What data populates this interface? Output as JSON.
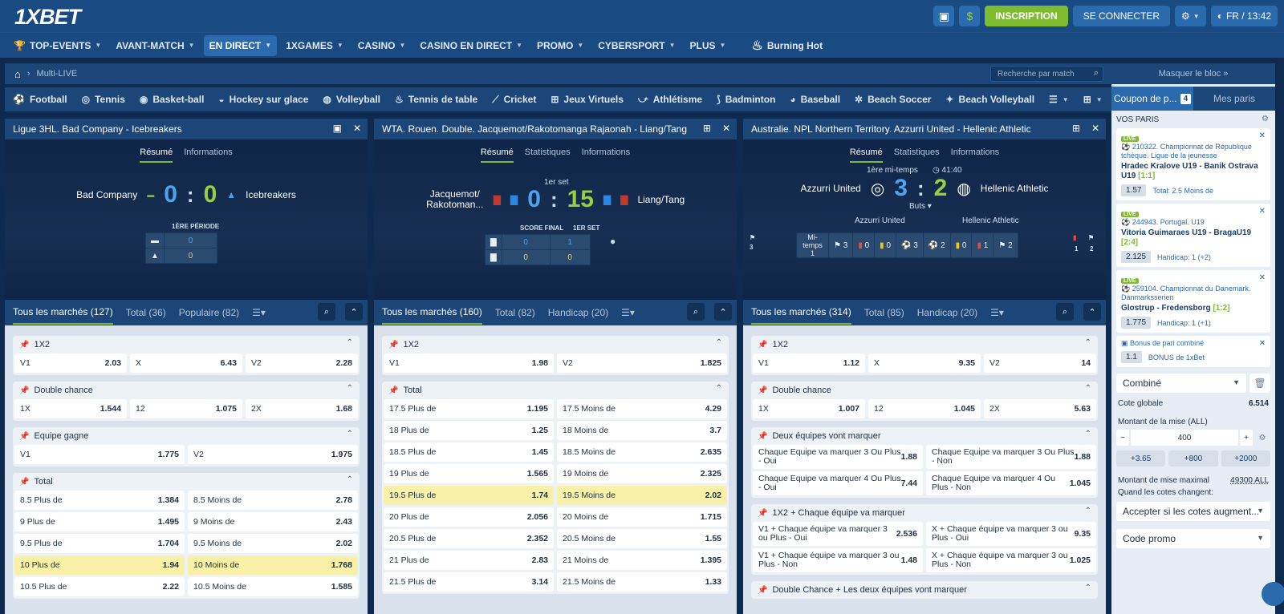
{
  "header": {
    "logo": "1XBET",
    "dollar": "$",
    "register": "INSCRIPTION",
    "login": "SE CONNECTER",
    "lang": "FR / 13:42"
  },
  "nav": {
    "items": [
      "TOP-EVENTS",
      "AVANT-MATCH",
      "EN DIRECT",
      "1XGAMES",
      "CASINO",
      "CASINO EN DIRECT",
      "PROMO",
      "CYBERSPORT",
      "PLUS"
    ],
    "burning": "Burning Hot"
  },
  "breadcrumb": {
    "item": "Multi-LIVE"
  },
  "search": {
    "placeholder": "Recherche par match"
  },
  "sports": [
    "Football",
    "Tennis",
    "Basket-ball",
    "Hockey sur glace",
    "Volleyball",
    "Tennis de table",
    "Cricket",
    "Jeux Virtuels",
    "Athlétisme",
    "Badminton",
    "Baseball",
    "Beach Soccer",
    "Beach Volleyball"
  ],
  "coupon": {
    "hide": "Masquer le bloc",
    "tab1": "Coupon de p...",
    "count": "4",
    "tab2": "Mes paris",
    "vos": "VOS PARIS",
    "bets": [
      {
        "league": "210322. Championnat de République tchèque. Ligue de la jeunesse",
        "match": "Hradec Kralove U19 - Banik Ostrava U19",
        "score": "[1:1]",
        "odd": "1.57",
        "type": "Total: 2.5 Moins de"
      },
      {
        "league": "244943. Portugal. U19",
        "match": "Vitoria Guimaraes U19 - BragaU19",
        "score": "[2:4]",
        "odd": "2.125",
        "type": "Handicap: 1 (+2)"
      },
      {
        "league": "259104. Championnat du Danemark. Danmarksserien",
        "match": "Glostrup - Fredensborg",
        "score": "[1:2]",
        "odd": "1.775",
        "type": "Handicap: 1 (+1)"
      }
    ],
    "bonus": {
      "label": "Bonus de pari combiné",
      "odd": "1.1",
      "name": "BONUS de 1xBet"
    },
    "combine": "Combiné",
    "global_label": "Cote globale",
    "global_value": "6.514",
    "stake_label": "Montant de la mise (ALL)",
    "stake": "400",
    "quick": [
      "+3.65",
      "+800",
      "+2000"
    ],
    "max_label": "Montant de mise maximal",
    "max_value": "49300 ALL",
    "change_label": "Quand les cotes changent:",
    "accept": "Accepter si les cotes augment...",
    "promo": "Code promo"
  },
  "p1": {
    "title": "Ligue 3HL. Bad Company - Icebreakers",
    "tab1": "Résumé",
    "tab2": "Informations",
    "home": "Bad Company",
    "away": "Icebreakers",
    "s1": "0",
    "s2": "0",
    "period": "1ÈRE PÉRIODE",
    "m1": "0",
    "m2": "0",
    "mk": {
      "a": "Tous les marchés (127)",
      "b": "Total (36)",
      "c": "Populaire (82)"
    },
    "g1": {
      "name": "1X2",
      "cells": [
        [
          "V1",
          "2.03"
        ],
        [
          "X",
          "6.43"
        ],
        [
          "V2",
          "2.28"
        ]
      ]
    },
    "g2": {
      "name": "Double chance",
      "cells": [
        [
          "1X",
          "1.544"
        ],
        [
          "12",
          "1.075"
        ],
        [
          "2X",
          "1.68"
        ]
      ]
    },
    "g3": {
      "name": "Equipe gagne",
      "cells": [
        [
          "V1",
          "1.775"
        ],
        [
          "V2",
          "1.975"
        ]
      ]
    },
    "g4": {
      "name": "Total",
      "rows": [
        [
          "8.5 Plus de",
          "1.384",
          "8.5 Moins de",
          "2.78"
        ],
        [
          "9 Plus de",
          "1.495",
          "9 Moins de",
          "2.43"
        ],
        [
          "9.5 Plus de",
          "1.704",
          "9.5 Moins de",
          "2.02"
        ],
        [
          "10 Plus de",
          "1.94",
          "10 Moins de",
          "1.768"
        ],
        [
          "10.5 Plus de",
          "2.22",
          "10.5 Moins de",
          "1.585"
        ]
      ]
    }
  },
  "p2": {
    "title": "WTA. Rouen. Double. Jacquemot/Rakotomanga Rajaonah - Liang/Tang",
    "tab1": "Résumé",
    "tab2": "Statistiques",
    "tab3": "Informations",
    "home": "Jacquemot/ Rakotoman...",
    "away": "Liang/Tang",
    "set": "1er set",
    "s1": "0",
    "s2": "15",
    "h1": "SCORE FINAL",
    "h2": "1ER SET",
    "r1": [
      "0",
      "1"
    ],
    "r2": [
      "0",
      "0"
    ],
    "mk": {
      "a": "Tous les marchés (160)",
      "b": "Total (82)",
      "c": "Handicap (20)"
    },
    "g1": {
      "name": "1X2",
      "cells": [
        [
          "V1",
          "1.98"
        ],
        [
          "V2",
          "1.825"
        ]
      ]
    },
    "g2": {
      "name": "Total",
      "rows": [
        [
          "17.5 Plus de",
          "1.195",
          "17.5 Moins de",
          "4.29"
        ],
        [
          "18 Plus de",
          "1.25",
          "18 Moins de",
          "3.7"
        ],
        [
          "18.5 Plus de",
          "1.45",
          "18.5 Moins de",
          "2.635"
        ],
        [
          "19 Plus de",
          "1.565",
          "19 Moins de",
          "2.325"
        ],
        [
          "19.5 Plus de",
          "1.74",
          "19.5 Moins de",
          "2.02"
        ],
        [
          "20 Plus de",
          "2.056",
          "20 Moins de",
          "1.715"
        ],
        [
          "20.5 Plus de",
          "2.352",
          "20.5 Moins de",
          "1.55"
        ],
        [
          "21 Plus de",
          "2.83",
          "21 Moins de",
          "1.395"
        ],
        [
          "21.5 Plus de",
          "3.14",
          "21.5 Moins de",
          "1.33"
        ]
      ]
    }
  },
  "p3": {
    "title": "Australie. NPL Northern Territory. Azzurri United - Hellenic Athletic",
    "tab1": "Résumé",
    "tab2": "Statistiques",
    "tab3": "Informations",
    "half": "1ère mi-temps",
    "time": "41:40",
    "home": "Azzurri United",
    "away": "Hellenic Athletic",
    "s1": "3",
    "s2": "2",
    "buts": "Buts",
    "mitemps": "Mi-temps 1",
    "stats": [
      "3",
      "0",
      "0",
      "3",
      "2",
      "0",
      "1",
      "2"
    ],
    "side1": "3",
    "side2": "1",
    "side3": "2",
    "mk": {
      "a": "Tous les marchés (314)",
      "b": "Total (85)",
      "c": "Handicap (20)"
    },
    "g1": {
      "name": "1X2",
      "cells": [
        [
          "V1",
          "1.12"
        ],
        [
          "X",
          "9.35"
        ],
        [
          "V2",
          "14"
        ]
      ]
    },
    "g2": {
      "name": "Double chance",
      "cells": [
        [
          "1X",
          "1.007"
        ],
        [
          "12",
          "1.045"
        ],
        [
          "2X",
          "5.63"
        ]
      ]
    },
    "g3": {
      "name": "Deux équipes vont marquer",
      "rows": [
        [
          "Chaque Equipe va marquer 3 Ou Plus - Oui",
          "1.88",
          "Chaque Equipe va marquer 3 Ou Plus - Non",
          "1.88"
        ],
        [
          "Chaque Equipe va marquer 4 Ou Plus - Oui",
          "7.44",
          "Chaque Equipe va marquer 4 Ou Plus - Non",
          "1.045"
        ]
      ]
    },
    "g4": {
      "name": "1X2 + Chaque équipe va marquer",
      "rows": [
        [
          "V1 + Chaque équipe va marquer 3 ou Plus - Oui",
          "2.536",
          "X + Chaque équipe va marquer 3 ou Plus - Oui",
          "9.35"
        ],
        [
          "V1 + Chaque équipe va marquer 3 ou Plus - Non",
          "1.48",
          "X + Chaque équipe va marquer 3 ou Plus - Non",
          "1.025"
        ]
      ]
    },
    "g5": {
      "name": "Double Chance + Les deux équipes vont marquer"
    }
  }
}
